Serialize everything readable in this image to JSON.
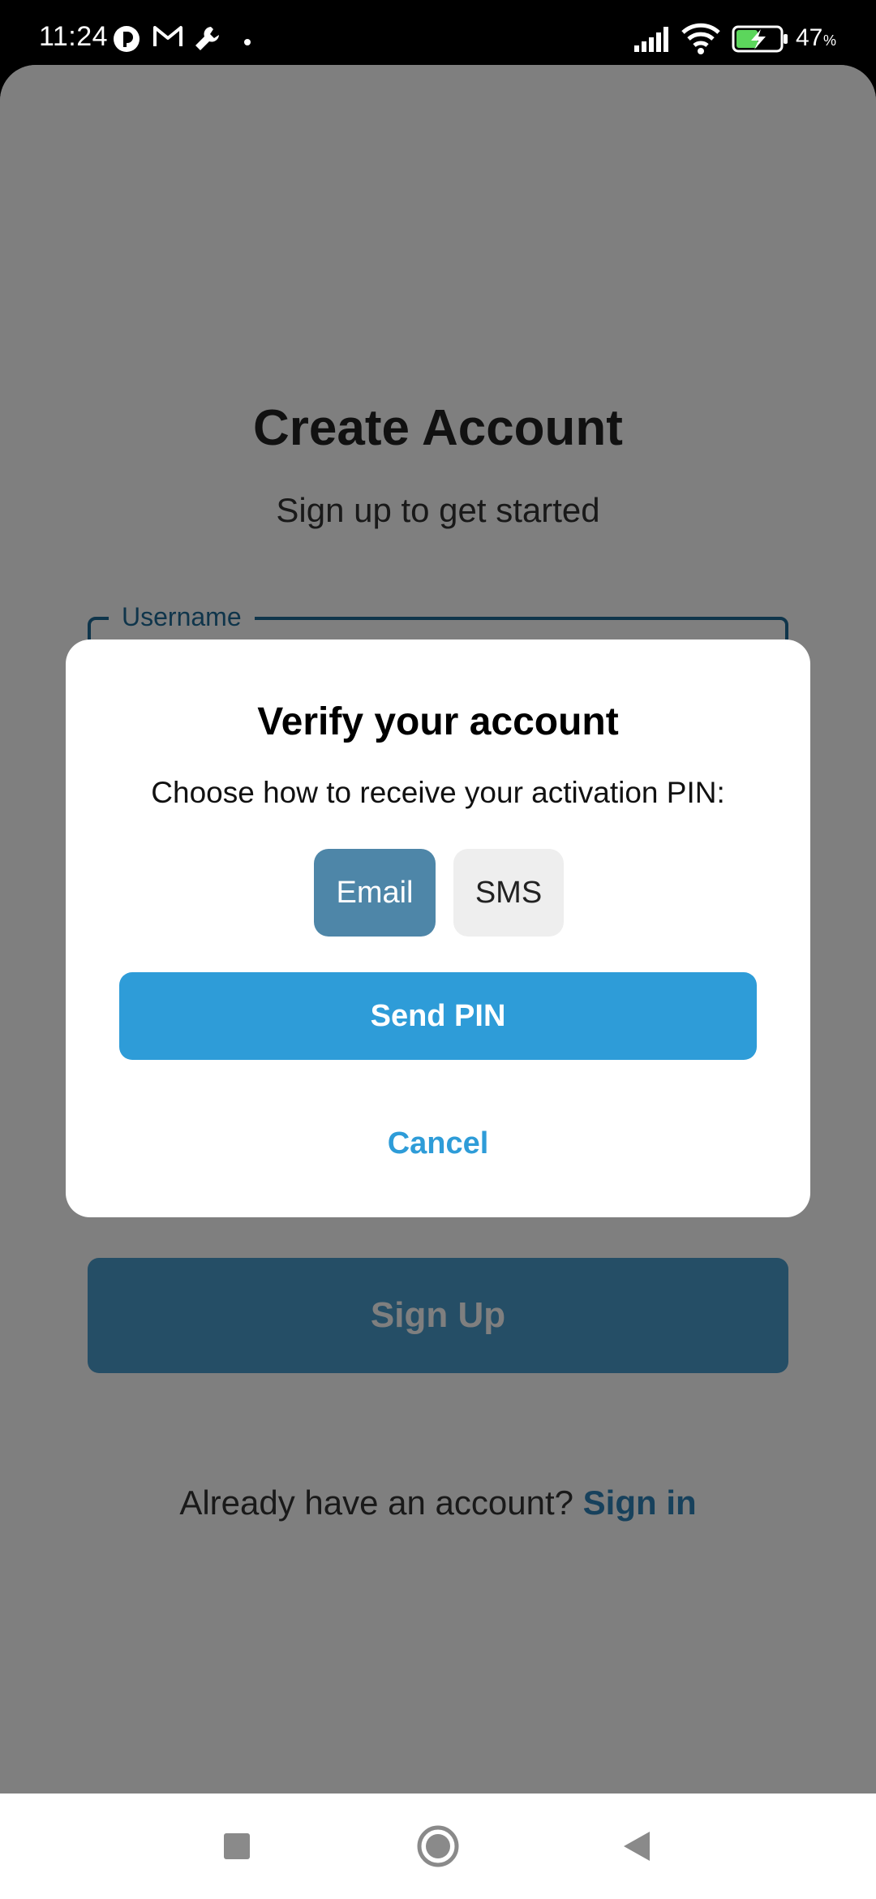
{
  "status_bar": {
    "time": "11:24",
    "battery_percent": "47",
    "battery_percent_sign": "%",
    "icons": [
      "app-notification-icon",
      "gmail-icon",
      "wrench-icon",
      "dot-icon",
      "signal-icon",
      "wifi-icon",
      "battery-charging-icon"
    ]
  },
  "page": {
    "title": "Create Account",
    "subtitle": "Sign up to get started",
    "username_label": "Username",
    "signup_label": "Sign Up",
    "signin_prompt": "Already have an account?",
    "signin_link": "Sign in"
  },
  "dialog": {
    "title": "Verify your account",
    "message": "Choose how to receive your activation PIN:",
    "options": [
      {
        "label": "Email",
        "selected": true
      },
      {
        "label": "SMS",
        "selected": false
      }
    ],
    "send_label": "Send PIN",
    "cancel_label": "Cancel"
  },
  "nav_bar": {
    "icons": [
      "recents-square-icon",
      "home-circle-icon",
      "back-triangle-icon"
    ]
  },
  "colors": {
    "accent": "#2e9cd8",
    "selected_option": "#4e86a8",
    "outline": "#1f6a96",
    "scrim": "rgba(0,0,0,0.5)"
  }
}
